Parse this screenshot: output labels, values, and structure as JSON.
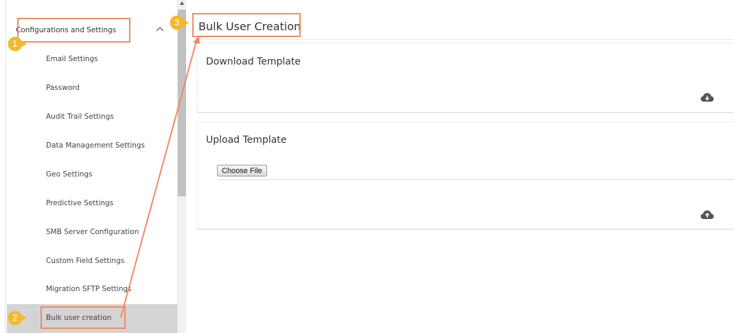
{
  "sidebar": {
    "group_label": "Configurations and Settings",
    "items": [
      {
        "label": "Email Settings"
      },
      {
        "label": "Password"
      },
      {
        "label": "Audit Trail Settings"
      },
      {
        "label": "Data Management Settings"
      },
      {
        "label": "Geo Settings"
      },
      {
        "label": "Predictive Settings"
      },
      {
        "label": "SMB Server Configuration"
      },
      {
        "label": "Custom Field Settings"
      },
      {
        "label": "Migration SFTP Settings"
      },
      {
        "label": "Bulk user creation",
        "active": true
      }
    ]
  },
  "main": {
    "title": "Bulk User Creation",
    "download_card": {
      "title": "Download Template",
      "icon": "cloud-download-icon"
    },
    "upload_card": {
      "title": "Upload Template",
      "choose_file_label": "Choose File",
      "icon": "cloud-upload-icon"
    }
  },
  "annotations": {
    "badges": [
      "1",
      "2",
      "3"
    ],
    "color": "#ee8b60",
    "badge_color": "#f2b930"
  },
  "colors": {
    "active_item_bg": "#d4d4d4",
    "icon_color": "#555555"
  }
}
